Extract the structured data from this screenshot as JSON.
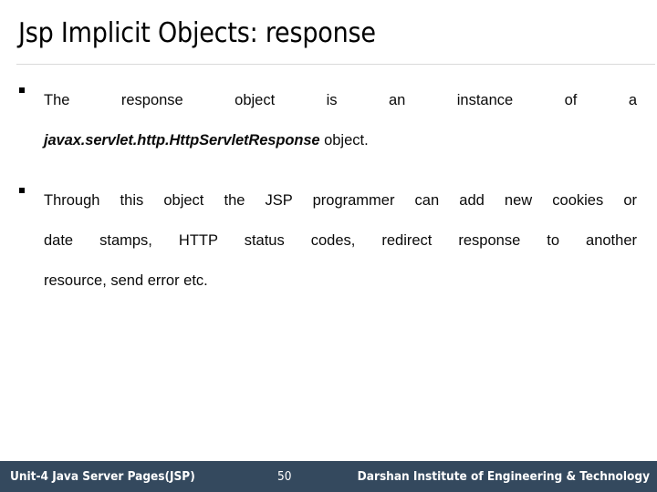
{
  "slide": {
    "title": "Jsp Implicit Objects: response",
    "background_color": "#ffffff",
    "title_color": "#000000",
    "rule_color": "#d9d9d9"
  },
  "bullets": [
    {
      "marker": "square-bullet",
      "line1": "The response object is an instance of a",
      "code": "javax.servlet.http.HttpServletResponse",
      "line2_tail": " object."
    },
    {
      "marker": "square-bullet",
      "line1": "Through this object the JSP programmer can add new cookies or",
      "line2": "date stamps, HTTP status codes, redirect response to another",
      "line3": "resource, send error etc."
    }
  ],
  "footer": {
    "background_color": "#34495e",
    "text_color": "#ffffff",
    "left_label": "Unit-4 Java Server Pages(JSP)",
    "page_number": "50",
    "right_label": "Darshan Institute of Engineering & Technology"
  }
}
